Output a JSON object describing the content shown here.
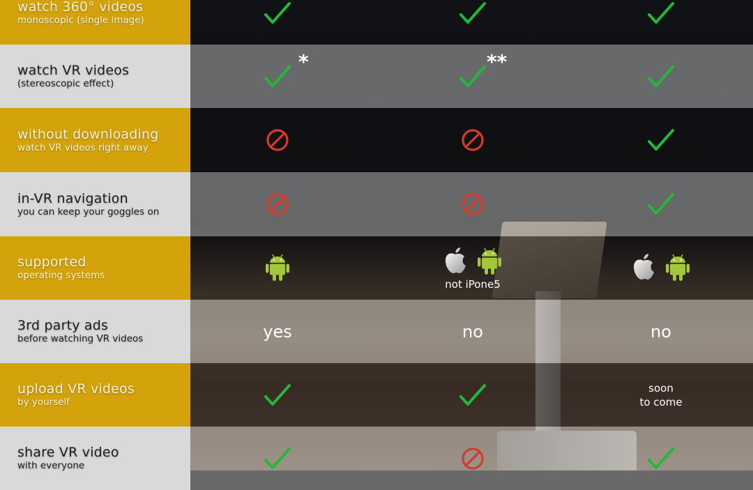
{
  "colors": {
    "accent_gold": "#d4a30b",
    "label_light": "#d9d9d9",
    "check_green": "#22b83a",
    "ban_red": "#d63a2a",
    "android_green": "#a4c639"
  },
  "rows": [
    {
      "title": "watch 360° videos",
      "subtitle": "monoscopic (single image)",
      "style": "gold",
      "cells": [
        {
          "type": "check",
          "icon": "checkmark-icon"
        },
        {
          "type": "check",
          "icon": "checkmark-icon"
        },
        {
          "type": "check",
          "icon": "checkmark-icon"
        }
      ]
    },
    {
      "title": "watch VR videos",
      "subtitle": "(stereoscopic effect)",
      "style": "light",
      "cells": [
        {
          "type": "check",
          "icon": "checkmark-icon",
          "footnote": "*"
        },
        {
          "type": "check",
          "icon": "checkmark-icon",
          "footnote": "**"
        },
        {
          "type": "check",
          "icon": "checkmark-icon"
        }
      ]
    },
    {
      "title": "without downloading",
      "subtitle": "watch VR videos right away",
      "style": "gold",
      "cells": [
        {
          "type": "ban",
          "icon": "prohibited-icon"
        },
        {
          "type": "ban",
          "icon": "prohibited-icon"
        },
        {
          "type": "check",
          "icon": "checkmark-icon"
        }
      ]
    },
    {
      "title": "in-VR navigation",
      "subtitle": "you can keep your goggles on",
      "style": "light",
      "cells": [
        {
          "type": "ban",
          "icon": "prohibited-icon"
        },
        {
          "type": "ban",
          "icon": "prohibited-icon"
        },
        {
          "type": "check",
          "icon": "checkmark-icon"
        }
      ]
    },
    {
      "title": "supported",
      "subtitle": "operating systems",
      "style": "gold",
      "cells": [
        {
          "type": "os",
          "os": [
            "android"
          ]
        },
        {
          "type": "os",
          "os": [
            "apple",
            "android"
          ],
          "note": "not iPone5"
        },
        {
          "type": "os",
          "os": [
            "apple",
            "android"
          ]
        }
      ]
    },
    {
      "title": "3rd party ads",
      "subtitle": "before watching VR videos",
      "style": "light",
      "cells": [
        {
          "type": "text",
          "text": "yes"
        },
        {
          "type": "text",
          "text": "no"
        },
        {
          "type": "text",
          "text": "no"
        }
      ]
    },
    {
      "title": "upload VR videos",
      "subtitle": "by yourself",
      "style": "gold",
      "cells": [
        {
          "type": "check",
          "icon": "checkmark-icon"
        },
        {
          "type": "check",
          "icon": "checkmark-icon"
        },
        {
          "type": "small",
          "lines": [
            "soon",
            "to come"
          ]
        }
      ]
    },
    {
      "title": "share VR video",
      "subtitle": "with everyone",
      "style": "light",
      "cells": [
        {
          "type": "check",
          "icon": "checkmark-icon"
        },
        {
          "type": "ban",
          "icon": "prohibited-icon"
        },
        {
          "type": "check",
          "icon": "checkmark-icon"
        }
      ]
    }
  ]
}
